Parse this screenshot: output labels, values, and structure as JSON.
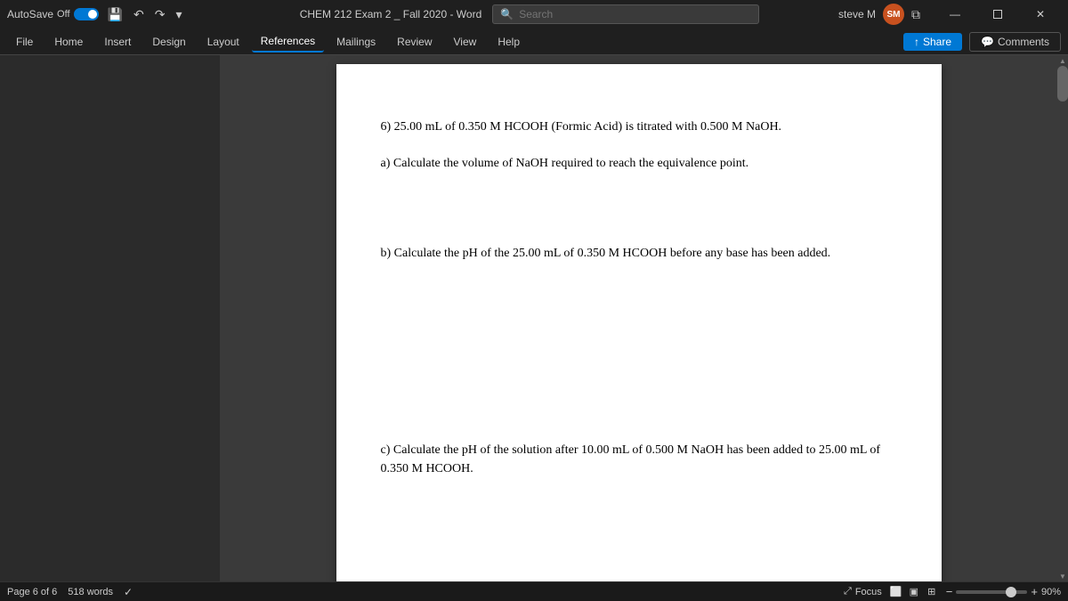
{
  "titlebar": {
    "autosave_label": "AutoSave",
    "autosave_state": "Off",
    "doc_title": "CHEM 212 Exam 2 _ Fall 2020 - Word",
    "search_placeholder": "Search",
    "user_name": "steve M",
    "user_initials": "SM"
  },
  "ribbon": {
    "tabs": [
      {
        "label": "File",
        "active": false
      },
      {
        "label": "Home",
        "active": false
      },
      {
        "label": "Insert",
        "active": false
      },
      {
        "label": "Design",
        "active": false
      },
      {
        "label": "Layout",
        "active": false
      },
      {
        "label": "References",
        "active": true
      },
      {
        "label": "Mailings",
        "active": false
      },
      {
        "label": "Review",
        "active": false
      },
      {
        "label": "View",
        "active": false
      },
      {
        "label": "Help",
        "active": false
      }
    ],
    "share_label": "Share",
    "comments_label": "Comments"
  },
  "document": {
    "question6": {
      "intro": "6) 25.00 mL of 0.350 M HCOOH (Formic Acid) is titrated with 0.500 M NaOH.",
      "part_a": "a) Calculate the volume of NaOH required to reach the equivalence point.",
      "part_b": "b) Calculate the pH of the 25.00 mL of 0.350 M HCOOH before any base has been added.",
      "part_c": "c) Calculate the pH of the solution after 10.00 mL of 0.500 M NaOH has been added to 25.00 mL of 0.350 M HCOOH."
    }
  },
  "statusbar": {
    "page_info": "Page 6 of 6",
    "word_count": "518 words",
    "focus_label": "Focus",
    "zoom_percent": "90%"
  }
}
